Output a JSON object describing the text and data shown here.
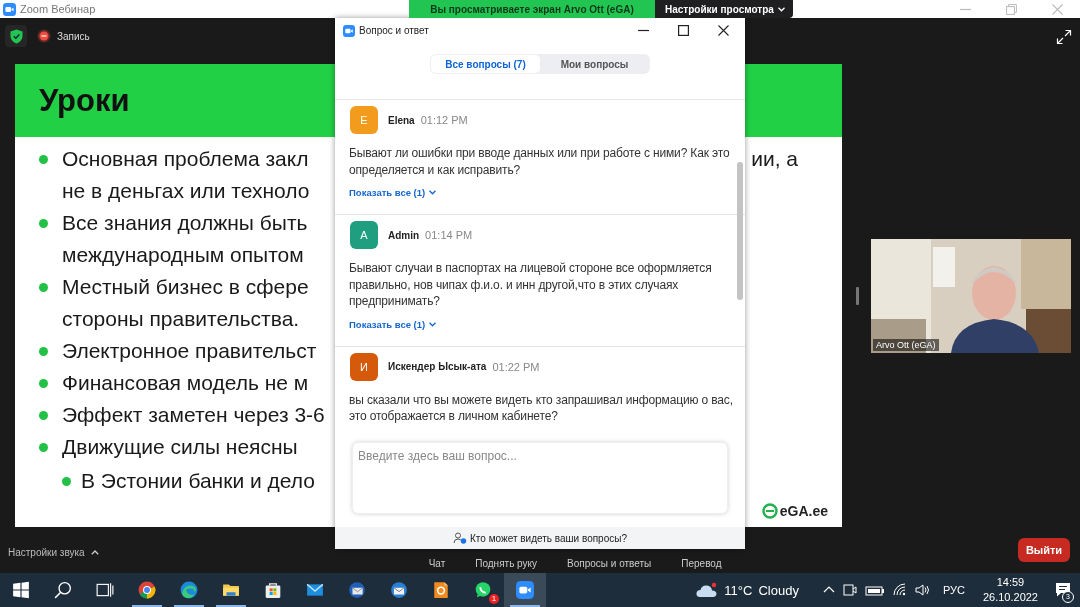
{
  "app_window": {
    "title": "Zoom Вебинар"
  },
  "share_banner": {
    "text": "Вы просматриваете экран Arvo Ott (eGA)",
    "view_options": "Настройки просмотра"
  },
  "meeting": {
    "recording_label": "Запись"
  },
  "slide": {
    "title": "Уроки",
    "bullets": [
      {
        "lines": [
          "Основная проблема закл",
          "не в деньгах или техноло"
        ],
        "right_text": "ии, а"
      },
      {
        "lines": [
          "Все знания должны быть",
          "международным опытом"
        ]
      },
      {
        "lines": [
          "Местный бизнес в сфере",
          "стороны правительства."
        ]
      },
      {
        "lines": [
          "Электронное правительст"
        ]
      },
      {
        "lines": [
          "Финансовая модель не м"
        ]
      },
      {
        "lines": [
          "Эффект заметен через 3-6"
        ]
      },
      {
        "lines": [
          "Движущие силы неясны"
        ],
        "children": [
          {
            "lines": [
              "В Эстонии банки и дело"
            ]
          }
        ]
      }
    ],
    "logo": "eGA.ee"
  },
  "video": {
    "name": "Arvo Ott (eGA)"
  },
  "controls": {
    "audio_settings": "Настройки звука",
    "toolbar": [
      "Чат",
      "Поднять руку",
      "Вопросы и ответы",
      "Перевод"
    ],
    "leave": "Выйти"
  },
  "qa_window": {
    "title": "Вопрос и ответ",
    "tabs": [
      {
        "label": "Все вопросы (7)",
        "selected": true
      },
      {
        "label": "Мои вопросы",
        "selected": false
      }
    ],
    "questions": [
      {
        "initial": "E",
        "color": "#f29b1c",
        "author": "Elena",
        "time": "01:12 PM",
        "text": "Бывают ли ошибки при вводе данных или при работе с ними? Как это определяется и как исправить?",
        "show_all": "Показать все (1)"
      },
      {
        "initial": "A",
        "color": "#1f9e80",
        "author": "Admin",
        "time": "01:14 PM",
        "text": "Бывают случаи в паспортах на лицевой стороне все оформляется правильно, нов чипах ф.и.о. и инн другой,что в этих случаях предпринимать?",
        "show_all": "Показать все (1)"
      },
      {
        "initial": "И",
        "color": "#d65a0c",
        "author": "Искендер Ысык-ата",
        "time": "01:22 PM",
        "text": "вы сказали что вы можете видеть кто запрашивал информацию о вас, это отображается в личном кабинете?"
      }
    ],
    "input": {
      "placeholder": "Введите здесь ваш вопрос..."
    },
    "visibility_note": "Кто может видеть ваши вопросы?"
  },
  "taskbar": {
    "apps": [
      {
        "kind": "start",
        "running": false,
        "active": false
      },
      {
        "kind": "search",
        "running": false,
        "active": false
      },
      {
        "kind": "taskview",
        "running": false,
        "active": false
      },
      {
        "kind": "chrome",
        "running": true,
        "active": false
      },
      {
        "kind": "edge",
        "running": true,
        "active": false
      },
      {
        "kind": "explorer",
        "running": true,
        "active": false
      },
      {
        "kind": "store",
        "running": false,
        "active": false
      },
      {
        "kind": "mail",
        "running": false,
        "active": false
      },
      {
        "kind": "thunderbird",
        "running": false,
        "active": false
      },
      {
        "kind": "outlook",
        "running": false,
        "active": false
      },
      {
        "kind": "foxit",
        "running": false,
        "active": false
      },
      {
        "kind": "whatsapp",
        "running": false,
        "active": false,
        "badge": "1"
      },
      {
        "kind": "zoom",
        "running": true,
        "active": true
      }
    ],
    "weather": {
      "temperature": "11°C",
      "condition": "Cloudy"
    },
    "tray": [
      {
        "kind": "chevron"
      },
      {
        "kind": "meet"
      },
      {
        "kind": "battery"
      },
      {
        "kind": "wifi"
      },
      {
        "kind": "volume"
      }
    ],
    "language": "РУС",
    "time": "14:59",
    "date": "26.10.2022",
    "notifications": "3"
  }
}
